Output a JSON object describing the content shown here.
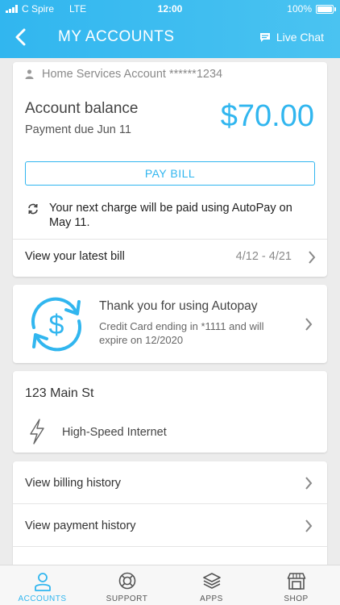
{
  "status_bar": {
    "carrier": "C Spire",
    "network": "LTE",
    "time": "12:00",
    "battery": "100%",
    "battery_level": 1.0
  },
  "nav": {
    "title": "MY ACCOUNTS",
    "live_chat_label": "Live Chat",
    "back_icon": "chevron-left-icon",
    "chat_icon": "chat-bubble-icon"
  },
  "account": {
    "header": "Home Services Account ******1234",
    "balance_label": "Account balance",
    "due_label": "Payment due Jun 11",
    "balance_value": "$70.00",
    "pay_button": "PAY BILL",
    "autopay_notice": "Your next charge will be paid using AutoPay on May 11.",
    "latest_bill_label": "View your latest bill",
    "latest_bill_range": "4/12 - 4/21"
  },
  "autopay": {
    "title": "Thank you for using Autopay",
    "detail": "Credit Card ending in *1111 and will expire on 12/2020"
  },
  "service": {
    "address": "123 Main St",
    "service_name": "High-Speed Internet"
  },
  "links": [
    {
      "label": "View billing history"
    },
    {
      "label": "View payment history"
    }
  ],
  "tabs": [
    {
      "label": "ACCOUNTS",
      "icon": "person-icon",
      "active": true
    },
    {
      "label": "SUPPORT",
      "icon": "lifebuoy-icon",
      "active": false
    },
    {
      "label": "APPS",
      "icon": "layers-icon",
      "active": false
    },
    {
      "label": "SHOP",
      "icon": "store-icon",
      "active": false
    }
  ],
  "colors": {
    "accent": "#31b6ef",
    "background": "#ececec"
  }
}
